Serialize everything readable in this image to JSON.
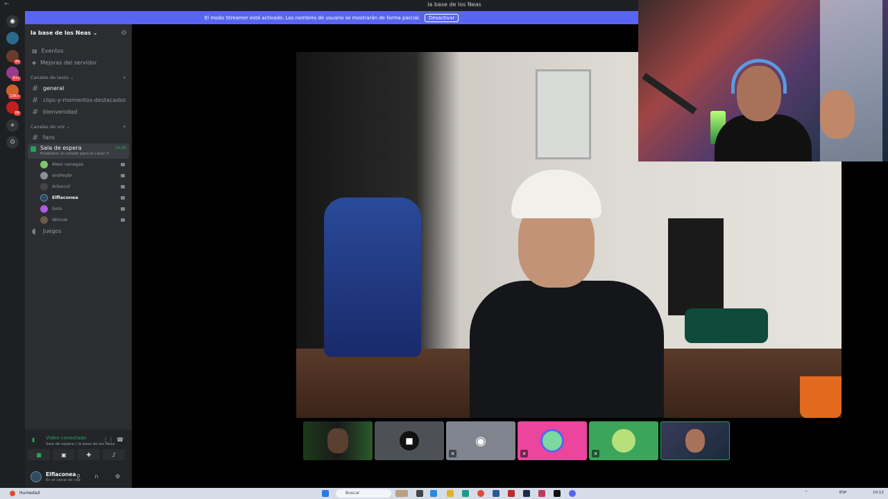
{
  "window": {
    "title": "la base de los Neas"
  },
  "banner": {
    "message": "El modo Streamer está activado. Los nombres de usuario se mostrarán de forma parcial.",
    "deactivate_label": "Desactivar"
  },
  "guilds": [
    {
      "icon": "discord-home-icon",
      "badge": ""
    },
    {
      "icon": "server-icon",
      "badge": ""
    },
    {
      "icon": "server-icon",
      "badge": "44"
    },
    {
      "icon": "server-icon",
      "badge": "811"
    },
    {
      "icon": "server-icon",
      "badge": "19K+"
    },
    {
      "icon": "server-icon",
      "badge": "68"
    }
  ],
  "server": {
    "name": "la base de los Neas ⌄",
    "events_label": "Eventos",
    "boost_label": "Mejoras del servidor",
    "text_category": "Canales de texto ⌄",
    "text_channels": [
      "general",
      "clips-y-momentos-destacados",
      "bienvenidad"
    ],
    "voice_category": "Canales de voz ⌄",
    "voice_channel_fans": "fans",
    "active_voice": {
      "name": "Sala de espera",
      "status": "Establece un estado para el canal ✎",
      "time": "44:46"
    },
    "members": [
      {
        "name": "Alexi vanegas",
        "color": "#7cc86a",
        "bold": false
      },
      {
        "name": "andreybr",
        "color": "#8a8f98",
        "bold": false
      },
      {
        "name": "Arlexcol",
        "color": "#444",
        "bold": false
      },
      {
        "name": "Elflaconea",
        "color": "#2f4b5c",
        "bold": true
      },
      {
        "name": "Soto",
        "color": "#b05adf",
        "bold": false
      },
      {
        "name": "Winnie",
        "color": "#6a5a4a",
        "bold": false
      }
    ],
    "voice_channel_games": "Juegos"
  },
  "voice_panel": {
    "connected_label": "Video conectado",
    "location": "Sala de espera / la base de los Neas"
  },
  "user": {
    "name": "Elflaconea",
    "status": "En el canal de voz"
  },
  "taskbar": {
    "weather": "Humedad",
    "search_placeholder": "Buscar",
    "lang": "ESP",
    "time": "10:12"
  },
  "colors": {
    "accent": "#5865f2",
    "voice_green": "#23a55a",
    "sidebar": "#2b2d31",
    "rail": "#1e1f22"
  }
}
